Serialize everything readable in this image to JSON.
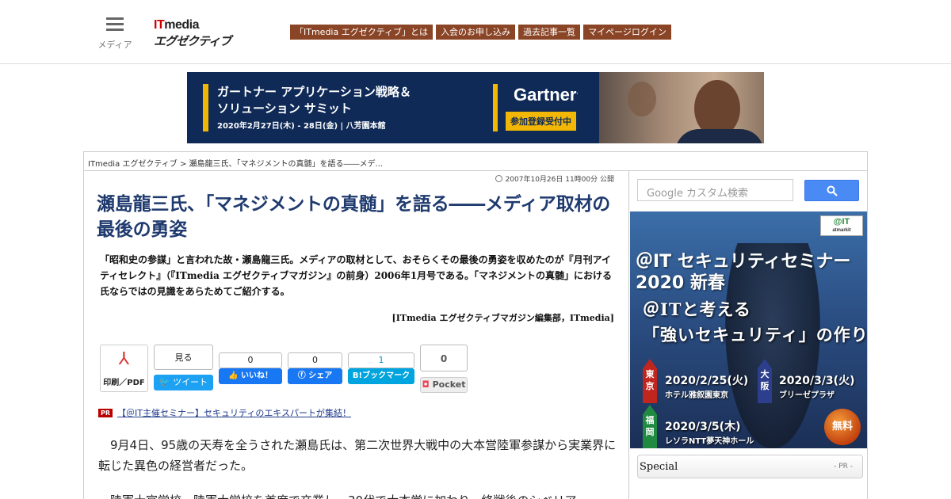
{
  "header": {
    "menu_label": "メディア",
    "logo_line1_it": "IT",
    "logo_line1_media": "media",
    "logo_line2": "エグゼクティブ",
    "nav": [
      "「ITmedia エグゼクティブ」とは",
      "入会のお申し込み",
      "過去記事一覧",
      "マイページログイン"
    ]
  },
  "banner_ad": {
    "line1": "ガートナー アプリケーション戦略＆",
    "line2": "ソリューション サミット",
    "line3": "2020年2月27日(木) - 28日(金) | 八芳園本館",
    "brand": "Gartner",
    "cta": "参加登録受付中"
  },
  "breadcrumb": {
    "home": "ITmedia エグゼクティブ",
    "sep": " > ",
    "current": "瀬島龍三氏、「マネジメントの真髄」を語る――メデ..."
  },
  "article": {
    "pubdate": "2007年10月26日 11時00分 公開",
    "title": "瀬島龍三氏、「マネジメントの真髄」を語る――メディア取材の最後の勇姿",
    "lead": "「昭和史の参謀」と言われた故・瀬島龍三氏。メディアの取材として、おそらくその最後の勇姿を収めたのが『月刊アイティセレクト』（『ITmedia エグゼクティブマガジン』の前身）2006年1月号である。「マネジメントの真髄」における氏ならではの見識をあらためてご紹介する。",
    "byline": "[ITmedia エグゼクティブマガジン編集部，ITmedia]",
    "share": {
      "pdf_label": "印刷／PDF",
      "twitter_count": "見る",
      "twitter_label": "ツイート",
      "fb_like_count": "0",
      "fb_like_label": "いいね！",
      "fb_share_count": "0",
      "fb_share_label": "シェア",
      "hatena_count": "1",
      "hatena_label": "B!ブックマーク",
      "pocket_count": "0",
      "pocket_label": "Pocket"
    },
    "pr_badge": "PR",
    "pr_link": "【＠IT主催セミナー】セキュリティのエキスパートが集結！",
    "para1": "　9月4日、95歳の天寿を全うされた瀬島氏は、第二次世界大戦中の大本営陸軍参謀から実業界に転じた異色の経営者だった。",
    "para2": "　陸軍士官学校、陸軍大学校を首席で卒業し、30代で大本営に加わり、終戦後のシベリア"
  },
  "sidebar": {
    "search_placeholder": "Google カスタム検索",
    "ad": {
      "logo": "@IT",
      "logo_sub": "atmarkit",
      "head1": "＠IT セキュリティセミナー",
      "head2": "2020 新春",
      "sub1": "＠ITと考える",
      "sub2": "「強いセキュリティ」の作り方",
      "tokyo": "東京",
      "tokyo_date": "2020/2/25(火)",
      "tokyo_venue": "ホテル雅叙園東京",
      "osaka": "大阪",
      "osaka_date": "2020/3/3(火)",
      "osaka_venue": "ブリーゼプラザ",
      "fukuoka": "福岡",
      "fukuoka_date": "2020/3/5(木)",
      "fukuoka_venue": "レソラNTT夢天神ホール",
      "free": "無料"
    },
    "special_label": "Special",
    "special_pr": "- PR -"
  },
  "colors": {
    "nav_bg": "#8a4426",
    "title": "#1f3a6e",
    "banner_bg": "#0f2a57",
    "accent_yellow": "#f2b705"
  }
}
